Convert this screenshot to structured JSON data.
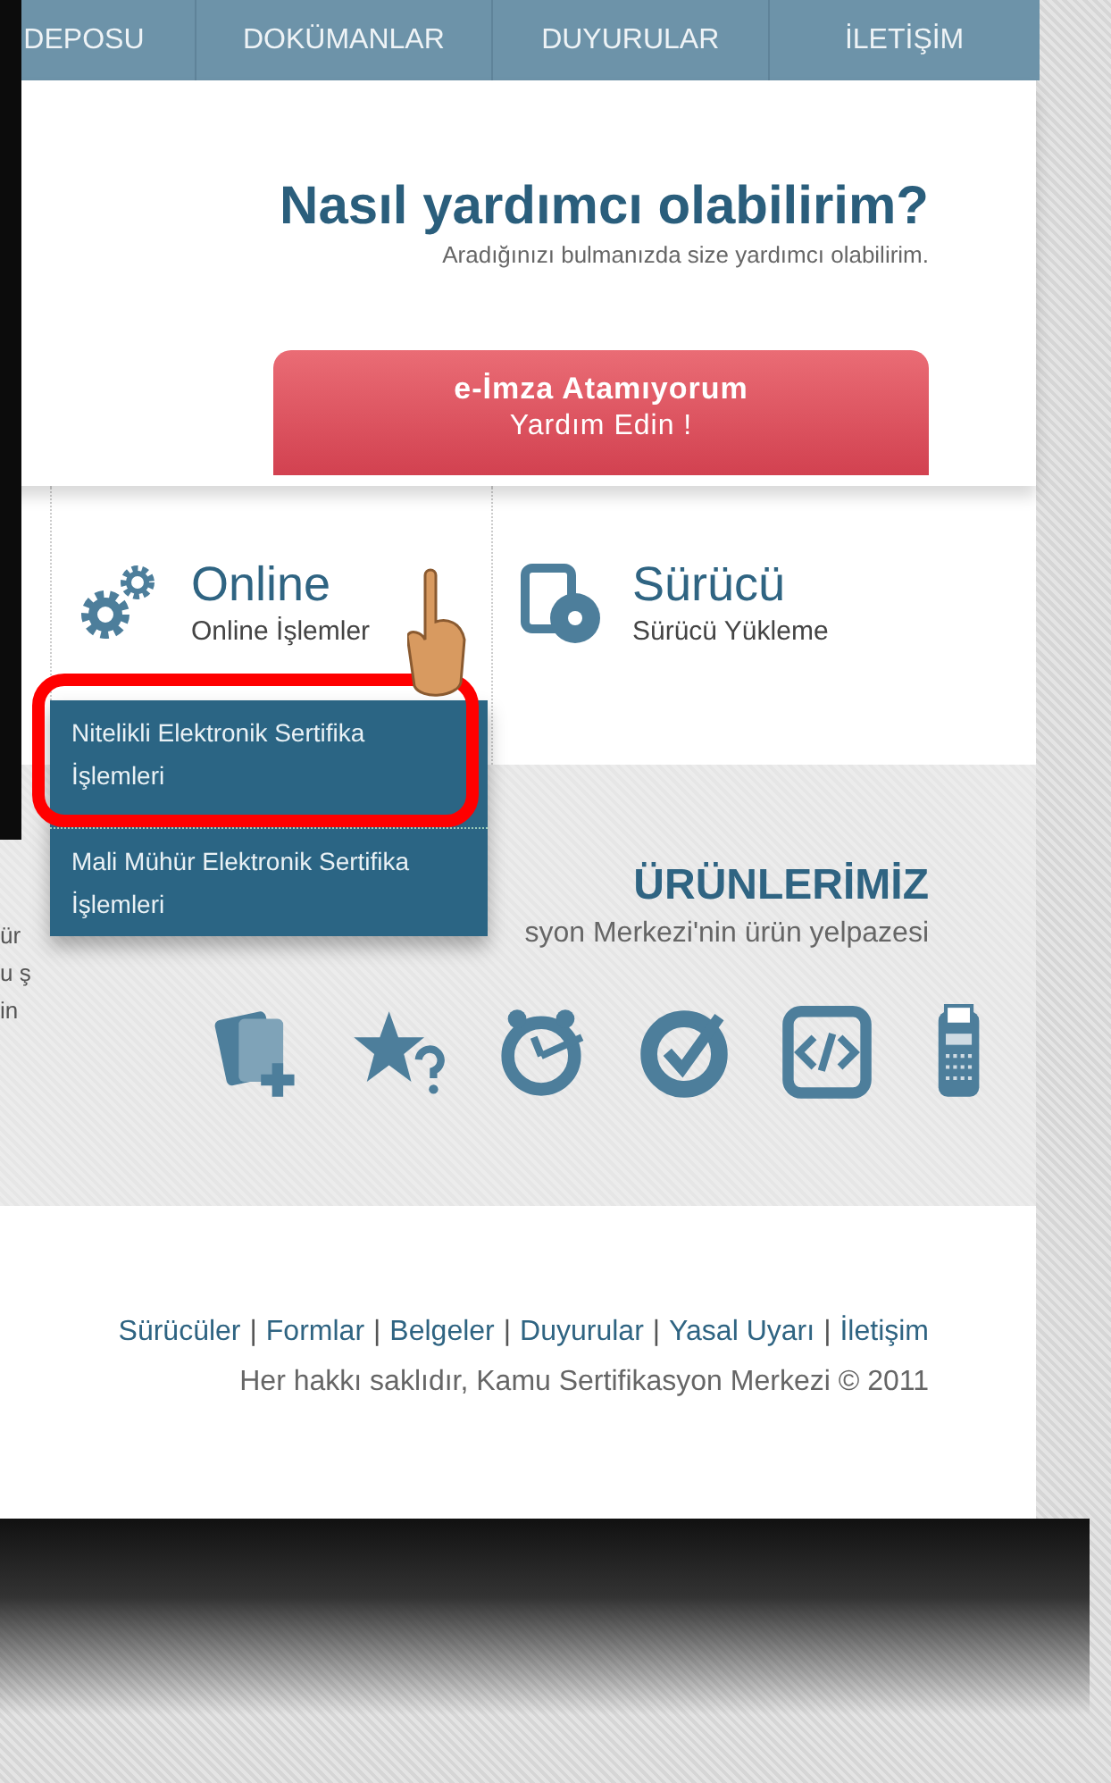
{
  "nav": {
    "items": [
      {
        "label": "DEPOSU"
      },
      {
        "label": "DOKÜMANLAR"
      },
      {
        "label": "DUYURULAR"
      },
      {
        "label": "İLETİŞİM"
      }
    ]
  },
  "hero": {
    "title": "Nasıl yardımcı olabilirim?",
    "subtitle": "Aradığınızı bulmanızda size yardımcı olabilirim.",
    "button": {
      "line_1": "e-İmza Atamıyorum",
      "line_2": "Yardım Edin !"
    }
  },
  "features": [
    {
      "kind": "gears",
      "title": "Online",
      "subtitle": "Online İşlemler"
    },
    {
      "kind": "disc",
      "title": "Sürücü",
      "subtitle": "Sürücü Yükleme"
    }
  ],
  "dropdown": {
    "items": [
      {
        "label": "Nitelikli Elektronik Sertifika İşlemleri",
        "highlighted": true
      },
      {
        "label": "Mali Mühür Elektronik Sertifika İşlemleri",
        "highlighted": false
      }
    ]
  },
  "products": {
    "title": "ÜRÜNLERİMİZ",
    "subtitle": "syon Merkezi'nin ürün yelpazesi",
    "side_text": [
      "ür",
      "u ş",
      "in"
    ],
    "icons": [
      {
        "kind": "cards"
      },
      {
        "kind": "star"
      },
      {
        "kind": "clock"
      },
      {
        "kind": "check"
      },
      {
        "kind": "code"
      },
      {
        "kind": "terminal"
      }
    ]
  },
  "footer": {
    "separator": "|",
    "links": [
      "Sürücüler",
      "Formlar",
      "Belgeler",
      "Duyurular",
      "Yasal Uyarı",
      "İletişim"
    ],
    "copyright": "Her hakkı saklıdır, Kamu Sertifikasyon Merkezi © 2011"
  }
}
